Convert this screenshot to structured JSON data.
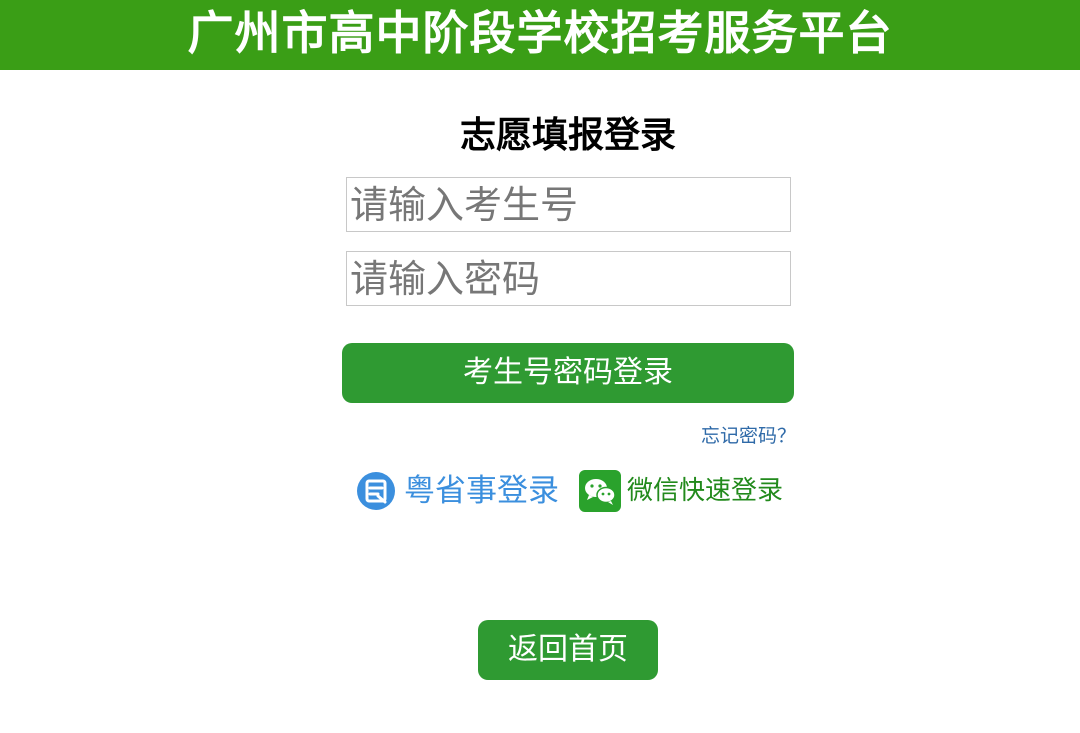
{
  "header": {
    "title": "广州市高中阶段学校招考服务平台"
  },
  "login": {
    "title": "志愿填报登录",
    "id_placeholder": "请输入考生号",
    "password_placeholder": "请输入密码",
    "submit_label": "考生号密码登录",
    "forgot_label": "忘记密码？"
  },
  "alt_login": {
    "yueshengshi_label": "粤省事登录",
    "yueshengshi_icon": "yueshengshi-logo-icon",
    "yueshengshi_color": "#3b8fde",
    "wechat_label": "微信快速登录",
    "wechat_icon": "wechat-logo-icon",
    "wechat_color": "#228a1c"
  },
  "footer": {
    "home_label": "返回首页"
  },
  "colors": {
    "header": "#3a9e16",
    "button": "#2f9a32",
    "link": "#2f6aa8"
  }
}
